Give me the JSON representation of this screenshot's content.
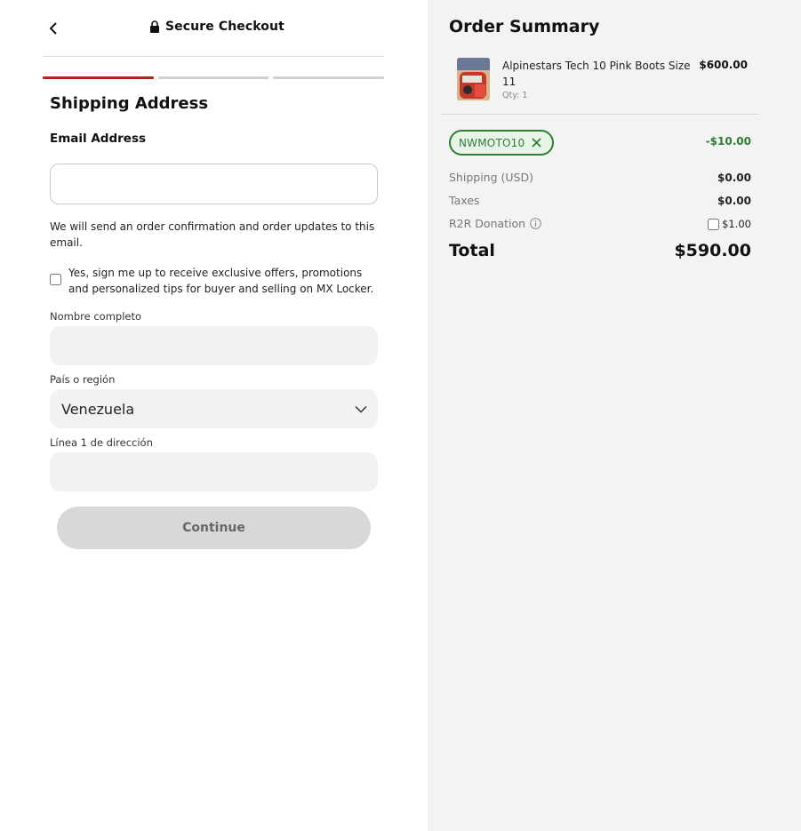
{
  "header": {
    "title": "Secure Checkout"
  },
  "form": {
    "section_title": "Shipping Address",
    "email_label": "Email Address",
    "email_value": "",
    "email_note": "We will send an order confirmation and order updates to this email.",
    "optin_text": "Yes, sign me up to receive exclusive offers, promotions and personalized tips for buyer and selling on MX Locker.",
    "full_name_label": "Nombre completo",
    "country_label": "País o región",
    "country_value": "Venezuela",
    "address1_label": "Línea 1 de dirección",
    "continue_label": "Continue"
  },
  "steps": {
    "total": 3,
    "current": 1
  },
  "summary": {
    "title": "Order Summary",
    "product": {
      "name": "Alpinestars Tech 10 Pink Boots Size 11",
      "qty": "Qty: 1",
      "price": "$600.00"
    },
    "promo": {
      "code": "NWMOTO10",
      "discount": "-$10.00"
    },
    "shipping_label": "Shipping (USD)",
    "shipping_value": "$0.00",
    "taxes_label": "Taxes",
    "taxes_value": "$0.00",
    "donation_label": "R2R Donation",
    "donation_value": "$1.00",
    "total_label": "Total",
    "total_value": "$590.00"
  },
  "colors": {
    "accent": "#b5231f",
    "promo_green": "#2e7d32",
    "summary_bg": "#f3f3f3"
  },
  "icons": {
    "back": "chevron-left-icon",
    "lock": "lock-icon",
    "dropdown": "chevron-down-icon",
    "remove_promo": "close-icon",
    "info": "info-icon"
  }
}
